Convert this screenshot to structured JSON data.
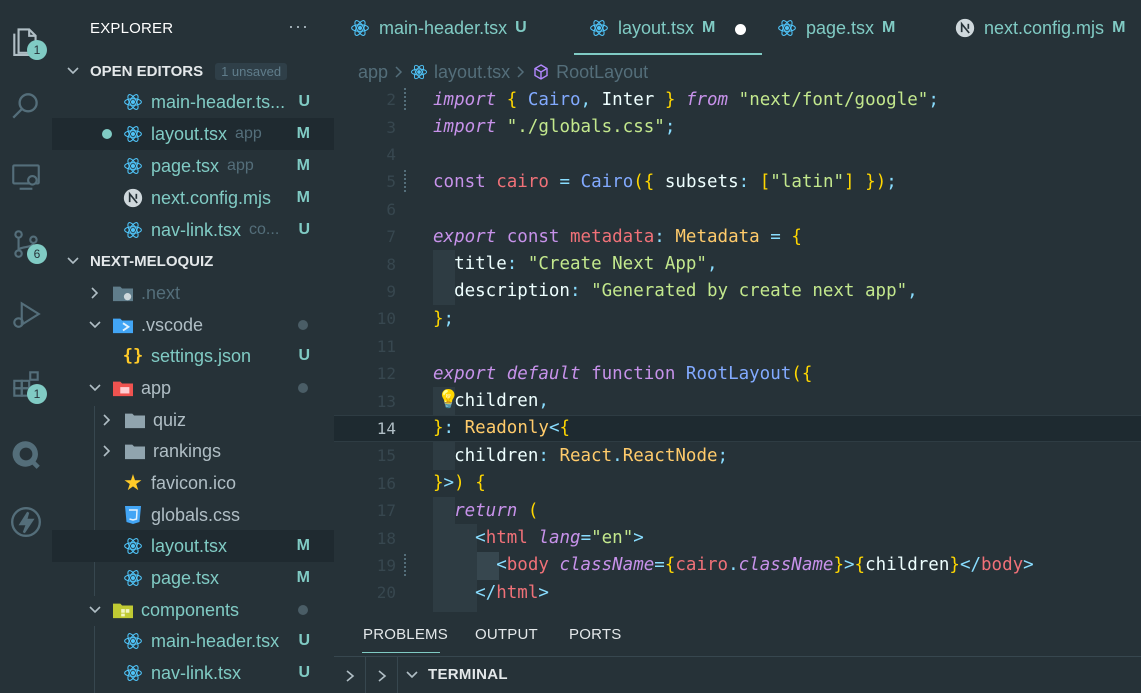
{
  "activity_bar": {
    "explorer_badge": "1",
    "source_control_badge": "6",
    "extensions_badge": "1"
  },
  "sidebar": {
    "title": "EXPLORER",
    "more": "···",
    "open_editors": {
      "label": "OPEN EDITORS",
      "badge": "1 unsaved",
      "items": [
        {
          "name": "main-header.ts...",
          "sub": "",
          "status": "U"
        },
        {
          "name": "layout.tsx",
          "sub": "app",
          "status": "M"
        },
        {
          "name": "page.tsx",
          "sub": "app",
          "status": "M"
        },
        {
          "name": "next.config.mjs",
          "sub": "",
          "status": "M"
        },
        {
          "name": "nav-link.tsx",
          "sub": "co...",
          "status": "U"
        }
      ]
    },
    "project": {
      "label": "NEXT-MELOQUIZ",
      "items": [
        {
          "name": ".next"
        },
        {
          "name": ".vscode"
        },
        {
          "name": "settings.json",
          "status": "U"
        },
        {
          "name": "app"
        },
        {
          "name": "quiz"
        },
        {
          "name": "rankings"
        },
        {
          "name": "favicon.ico"
        },
        {
          "name": "globals.css"
        },
        {
          "name": "layout.tsx",
          "status": "M"
        },
        {
          "name": "page.tsx",
          "status": "M"
        },
        {
          "name": "components"
        },
        {
          "name": "main-header.tsx",
          "status": "U"
        },
        {
          "name": "nav-link.tsx",
          "status": "U"
        }
      ]
    }
  },
  "tabs": [
    {
      "name": "main-header.tsx",
      "status": "U"
    },
    {
      "name": "layout.tsx",
      "status": "M"
    },
    {
      "name": "page.tsx",
      "status": "M"
    },
    {
      "name": "next.config.mjs",
      "status": "M"
    }
  ],
  "breadcrumb": [
    "app",
    "layout.tsx",
    "RootLayout"
  ],
  "code_lines": [
    {
      "n": "2",
      "t": "import { Cairo, Inter } from \"next/font/google\";"
    },
    {
      "n": "3",
      "t": "import \"./globals.css\";"
    },
    {
      "n": "4",
      "t": ""
    },
    {
      "n": "5",
      "t": "const cairo = Cairo({ subsets: [\"latin\"] });"
    },
    {
      "n": "6",
      "t": ""
    },
    {
      "n": "7",
      "t": "export const metadata: Metadata = {"
    },
    {
      "n": "8",
      "t": "  title: \"Create Next App\","
    },
    {
      "n": "9",
      "t": "  description: \"Generated by create next app\","
    },
    {
      "n": "10",
      "t": "};"
    },
    {
      "n": "11",
      "t": ""
    },
    {
      "n": "12",
      "t": "export default function RootLayout({"
    },
    {
      "n": "13",
      "t": "  children,"
    },
    {
      "n": "14",
      "t": "}: Readonly<{"
    },
    {
      "n": "15",
      "t": "  children: React.ReactNode;"
    },
    {
      "n": "16",
      "t": "}>) {"
    },
    {
      "n": "17",
      "t": "  return ("
    },
    {
      "n": "18",
      "t": "    <html lang=\"en\">"
    },
    {
      "n": "19",
      "t": "      <body className={cairo.className}>{children}</body>"
    },
    {
      "n": "20",
      "t": "    </html>"
    }
  ],
  "panel": {
    "tabs": [
      "PROBLEMS",
      "OUTPUT",
      "PORTS"
    ],
    "terminal": "TERMINAL"
  },
  "colors": {
    "accent": "#80cbc4",
    "background": "#263238",
    "keyword": "#c792ea",
    "string": "#c3e88d",
    "function": "#82aaff",
    "type": "#ffcb6b"
  }
}
